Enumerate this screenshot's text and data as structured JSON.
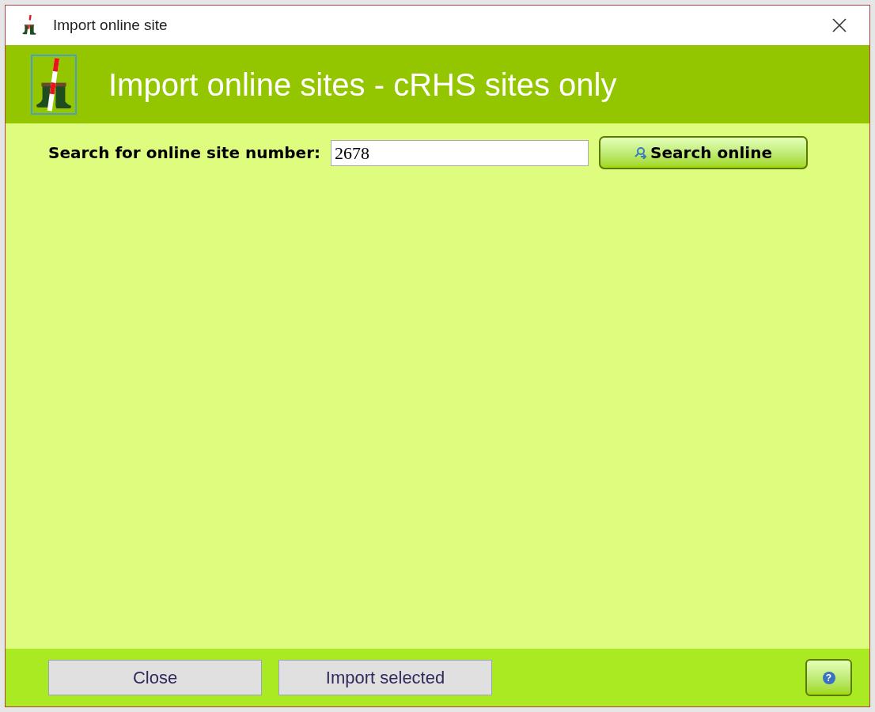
{
  "window": {
    "title": "Import online site"
  },
  "header": {
    "title": "Import online sites - cRHS sites only"
  },
  "search": {
    "label": "Search for online site number:",
    "value": "2678",
    "button": "Search online"
  },
  "footer": {
    "buttons": [
      "Close",
      "Import selected"
    ],
    "help": "?"
  }
}
